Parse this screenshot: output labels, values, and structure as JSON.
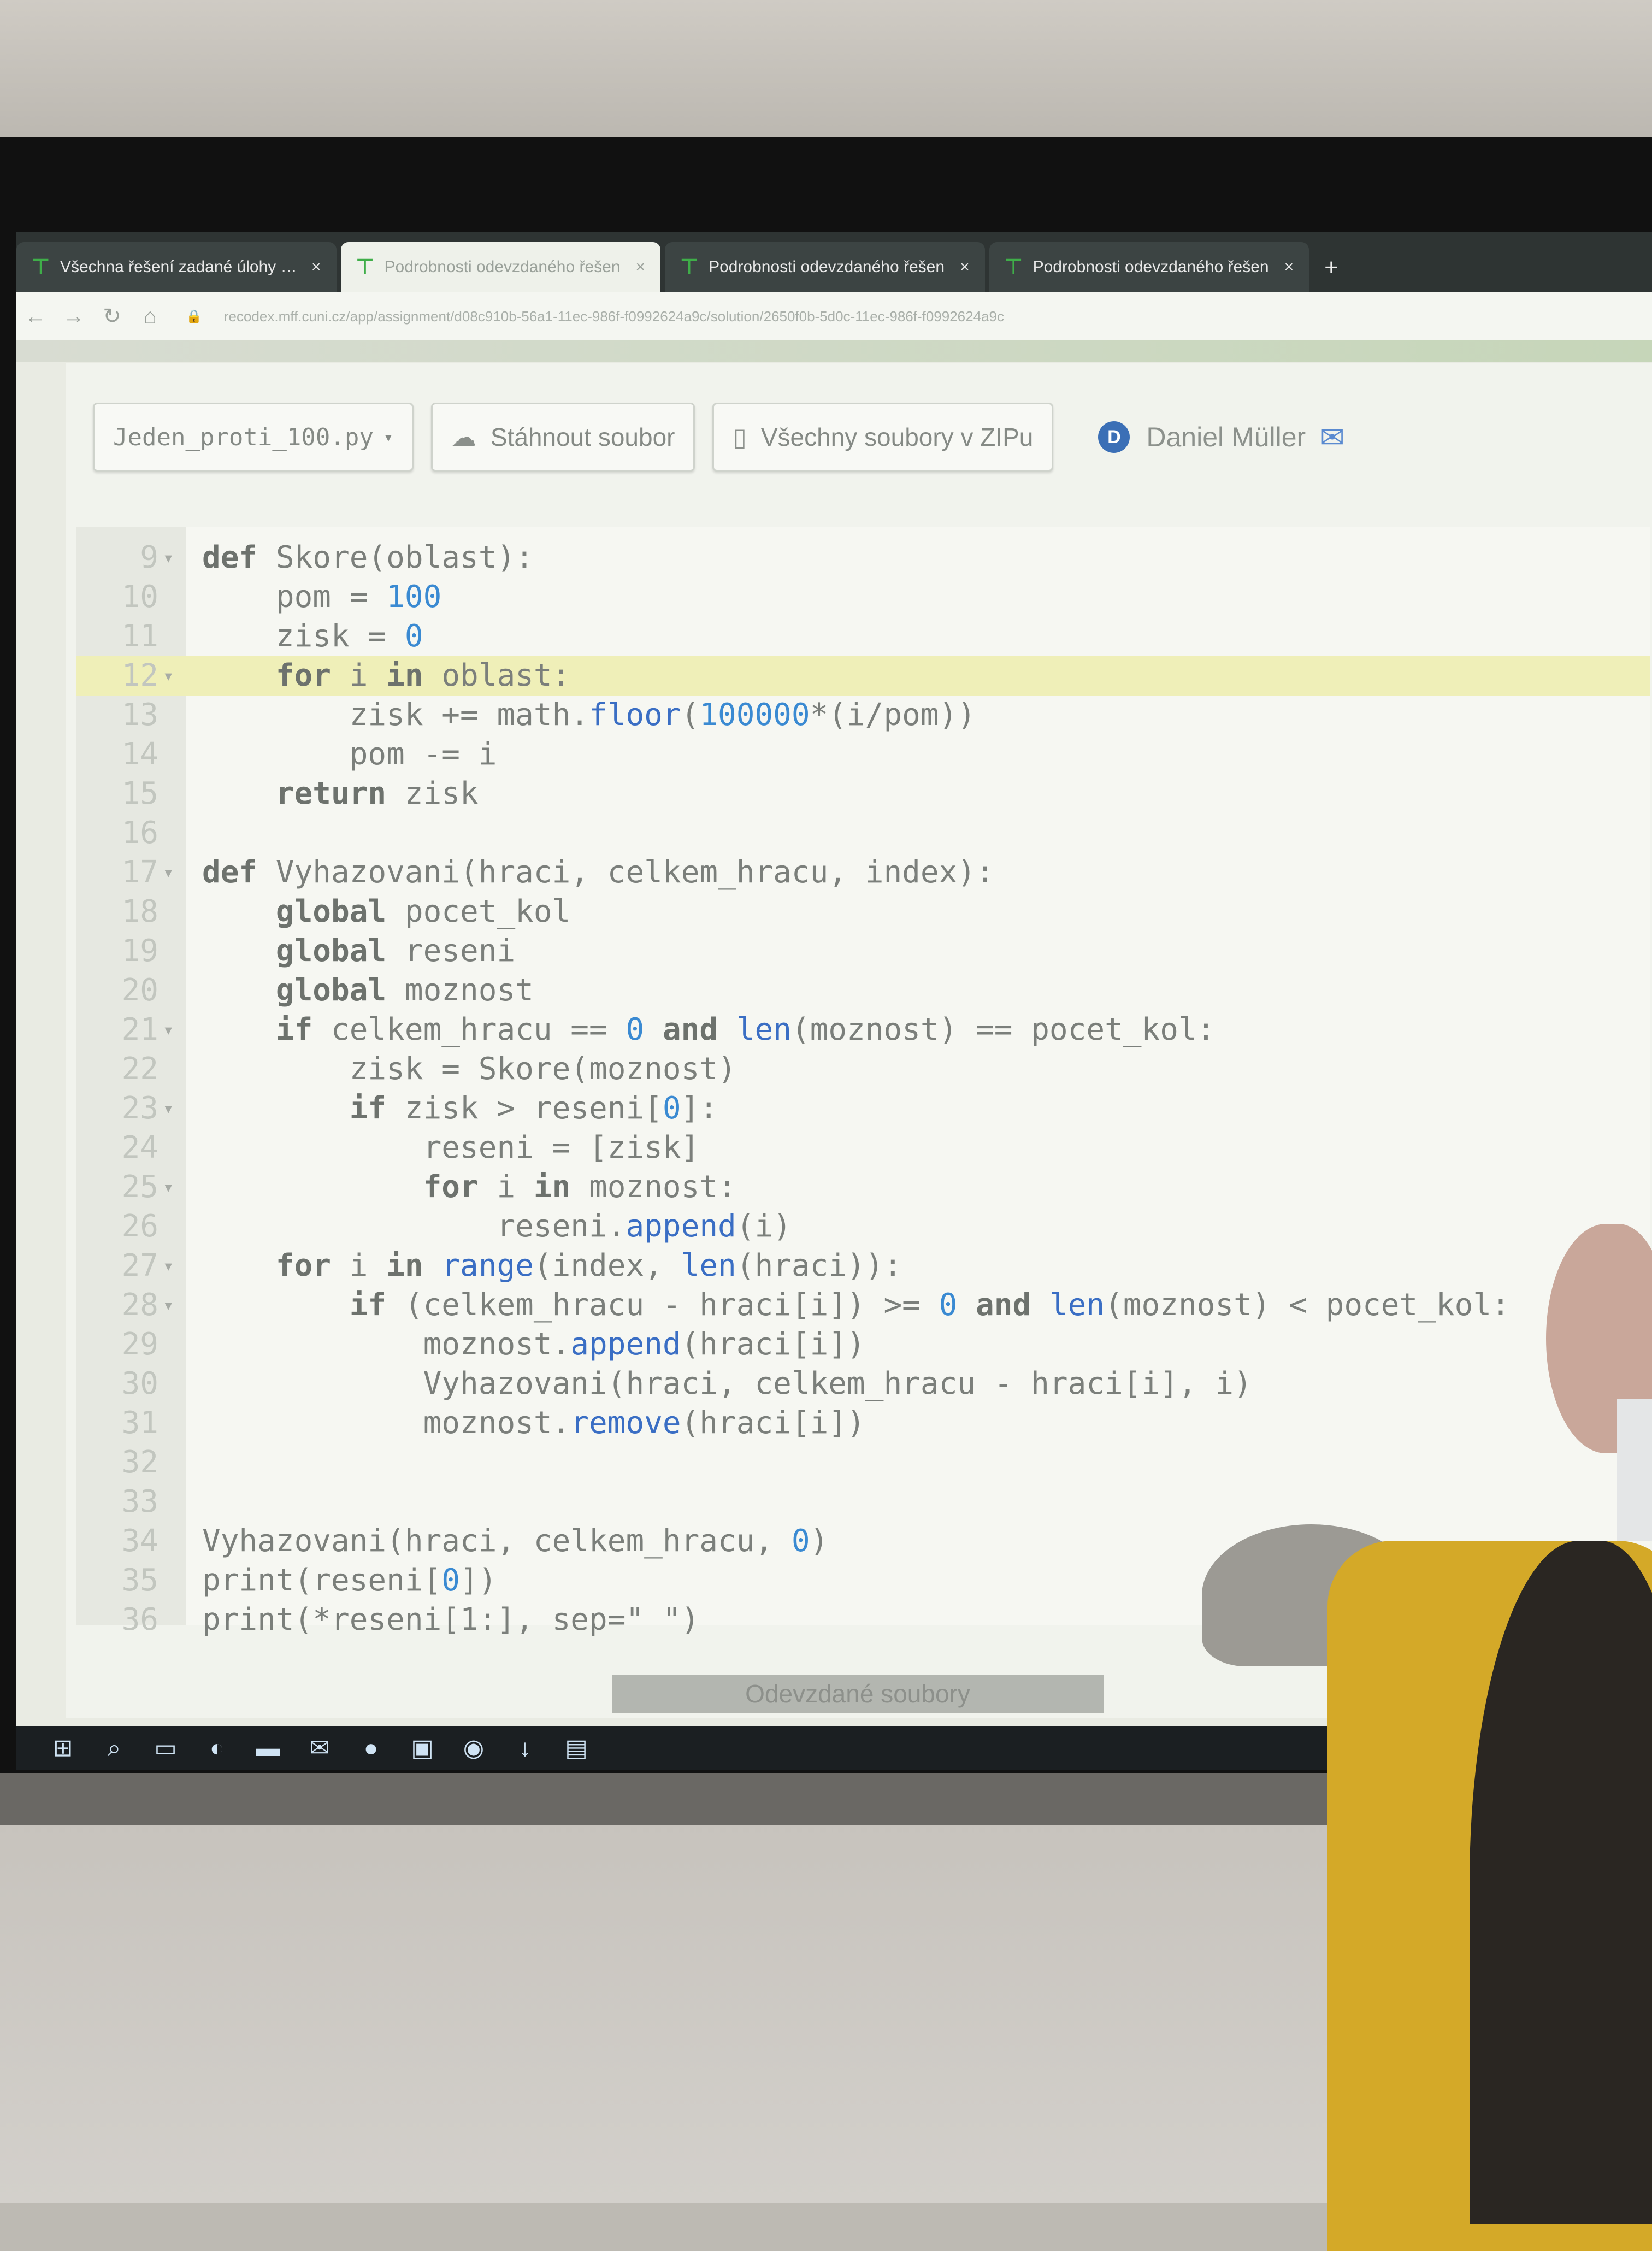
{
  "browser": {
    "tabs": [
      {
        "title": "Všechna řešení zadané úlohy | R",
        "active": false
      },
      {
        "title": "Podrobnosti odevzdaného řešen",
        "active": true
      },
      {
        "title": "Podrobnosti odevzdaného řešen",
        "active": false
      },
      {
        "title": "Podrobnosti odevzdaného řešen",
        "active": false
      }
    ],
    "close_glyph": "×",
    "new_tab_glyph": "+",
    "url": "recodex.mff.cuni.cz/app/assignment/d08c910b-56a1-11ec-986f-f0992624a9c/solution/2650f0b-5d0c-11ec-986f-f0992624a9c"
  },
  "toolbar": {
    "file_select": "Jeden_proti_100.py",
    "download_label": "Stáhnout soubor",
    "zip_label": "Všechny soubory v ZIPu",
    "user_initial": "D",
    "user_name": "Daniel Müller"
  },
  "editor": {
    "highlighted_line": 12,
    "lines": [
      {
        "n": "9",
        "fold": true,
        "html": "<span class=\"kw\">def</span> Skore(oblast):"
      },
      {
        "n": "10",
        "fold": false,
        "html": "    pom = <span class=\"num\">100</span>"
      },
      {
        "n": "11",
        "fold": false,
        "html": "    zisk = <span class=\"num\">0</span>"
      },
      {
        "n": "12",
        "fold": true,
        "html": "    <span class=\"kw\">for</span> i <span class=\"kw\">in</span> oblast:"
      },
      {
        "n": "13",
        "fold": false,
        "html": "        zisk += math.<span class=\"fn\">floor</span>(<span class=\"num\">100000</span>*(i/pom))"
      },
      {
        "n": "14",
        "fold": false,
        "html": "        pom -= i"
      },
      {
        "n": "15",
        "fold": false,
        "html": "    <span class=\"kw\">return</span> zisk"
      },
      {
        "n": "16",
        "fold": false,
        "html": ""
      },
      {
        "n": "17",
        "fold": true,
        "html": "<span class=\"kw\">def</span> Vyhazovani(hraci, celkem_hracu, index):"
      },
      {
        "n": "18",
        "fold": false,
        "html": "    <span class=\"kw\">global</span> pocet_kol"
      },
      {
        "n": "19",
        "fold": false,
        "html": "    <span class=\"kw\">global</span> reseni"
      },
      {
        "n": "20",
        "fold": false,
        "html": "    <span class=\"kw\">global</span> moznost"
      },
      {
        "n": "21",
        "fold": true,
        "html": "    <span class=\"kw\">if</span> celkem_hracu == <span class=\"num\">0</span> <span class=\"kw\">and</span> <span class=\"fn\">len</span>(moznost) == pocet_kol:"
      },
      {
        "n": "22",
        "fold": false,
        "html": "        zisk = Skore(moznost)"
      },
      {
        "n": "23",
        "fold": true,
        "html": "        <span class=\"kw\">if</span> zisk > reseni[<span class=\"num\">0</span>]:"
      },
      {
        "n": "24",
        "fold": false,
        "html": "            reseni = [zisk]"
      },
      {
        "n": "25",
        "fold": true,
        "html": "            <span class=\"kw\">for</span> i <span class=\"kw\">in</span> moznost:"
      },
      {
        "n": "26",
        "fold": false,
        "html": "                reseni.<span class=\"fn\">append</span>(i)"
      },
      {
        "n": "27",
        "fold": true,
        "html": "    <span class=\"kw\">for</span> i <span class=\"kw\">in</span> <span class=\"fn\">range</span>(index, <span class=\"fn\">len</span>(hraci)):"
      },
      {
        "n": "28",
        "fold": true,
        "html": "        <span class=\"kw\">if</span> (celkem_hracu - hraci[i]) >= <span class=\"num\">0</span> <span class=\"kw\">and</span> <span class=\"fn\">len</span>(moznost) < pocet_kol:"
      },
      {
        "n": "29",
        "fold": false,
        "html": "            moznost.<span class=\"fn\">append</span>(hraci[i])"
      },
      {
        "n": "30",
        "fold": false,
        "html": "            Vyhazovani(hraci, celkem_hracu - hraci[i], i)"
      },
      {
        "n": "31",
        "fold": false,
        "html": "            moznost.<span class=\"fn\">remove</span>(hraci[i])"
      },
      {
        "n": "32",
        "fold": false,
        "html": ""
      },
      {
        "n": "33",
        "fold": false,
        "html": ""
      },
      {
        "n": "34",
        "fold": false,
        "html": "Vyhazovani(hraci, celkem_hracu, <span class=\"num\">0</span>)"
      },
      {
        "n": "35",
        "fold": false,
        "html": "print(reseni[<span class=\"num\">0</span>])"
      },
      {
        "n": "36",
        "fold": false,
        "html": "print(*reseni[1:], sep=\" \")"
      }
    ]
  },
  "page_footer_label": "Odevzdané soubory",
  "taskbar": {
    "icons": [
      "windows-start-icon",
      "search-icon",
      "task-view-icon",
      "edge-icon",
      "file-explorer-icon",
      "mail-icon",
      "firefox-icon",
      "store-icon",
      "chrome-icon",
      "download-icon",
      "remote-desktop-icon"
    ]
  },
  "colors": {
    "line_highlight": "#efefb8",
    "number_color": "#3a8ad2",
    "brand_green": "#3fae49"
  }
}
